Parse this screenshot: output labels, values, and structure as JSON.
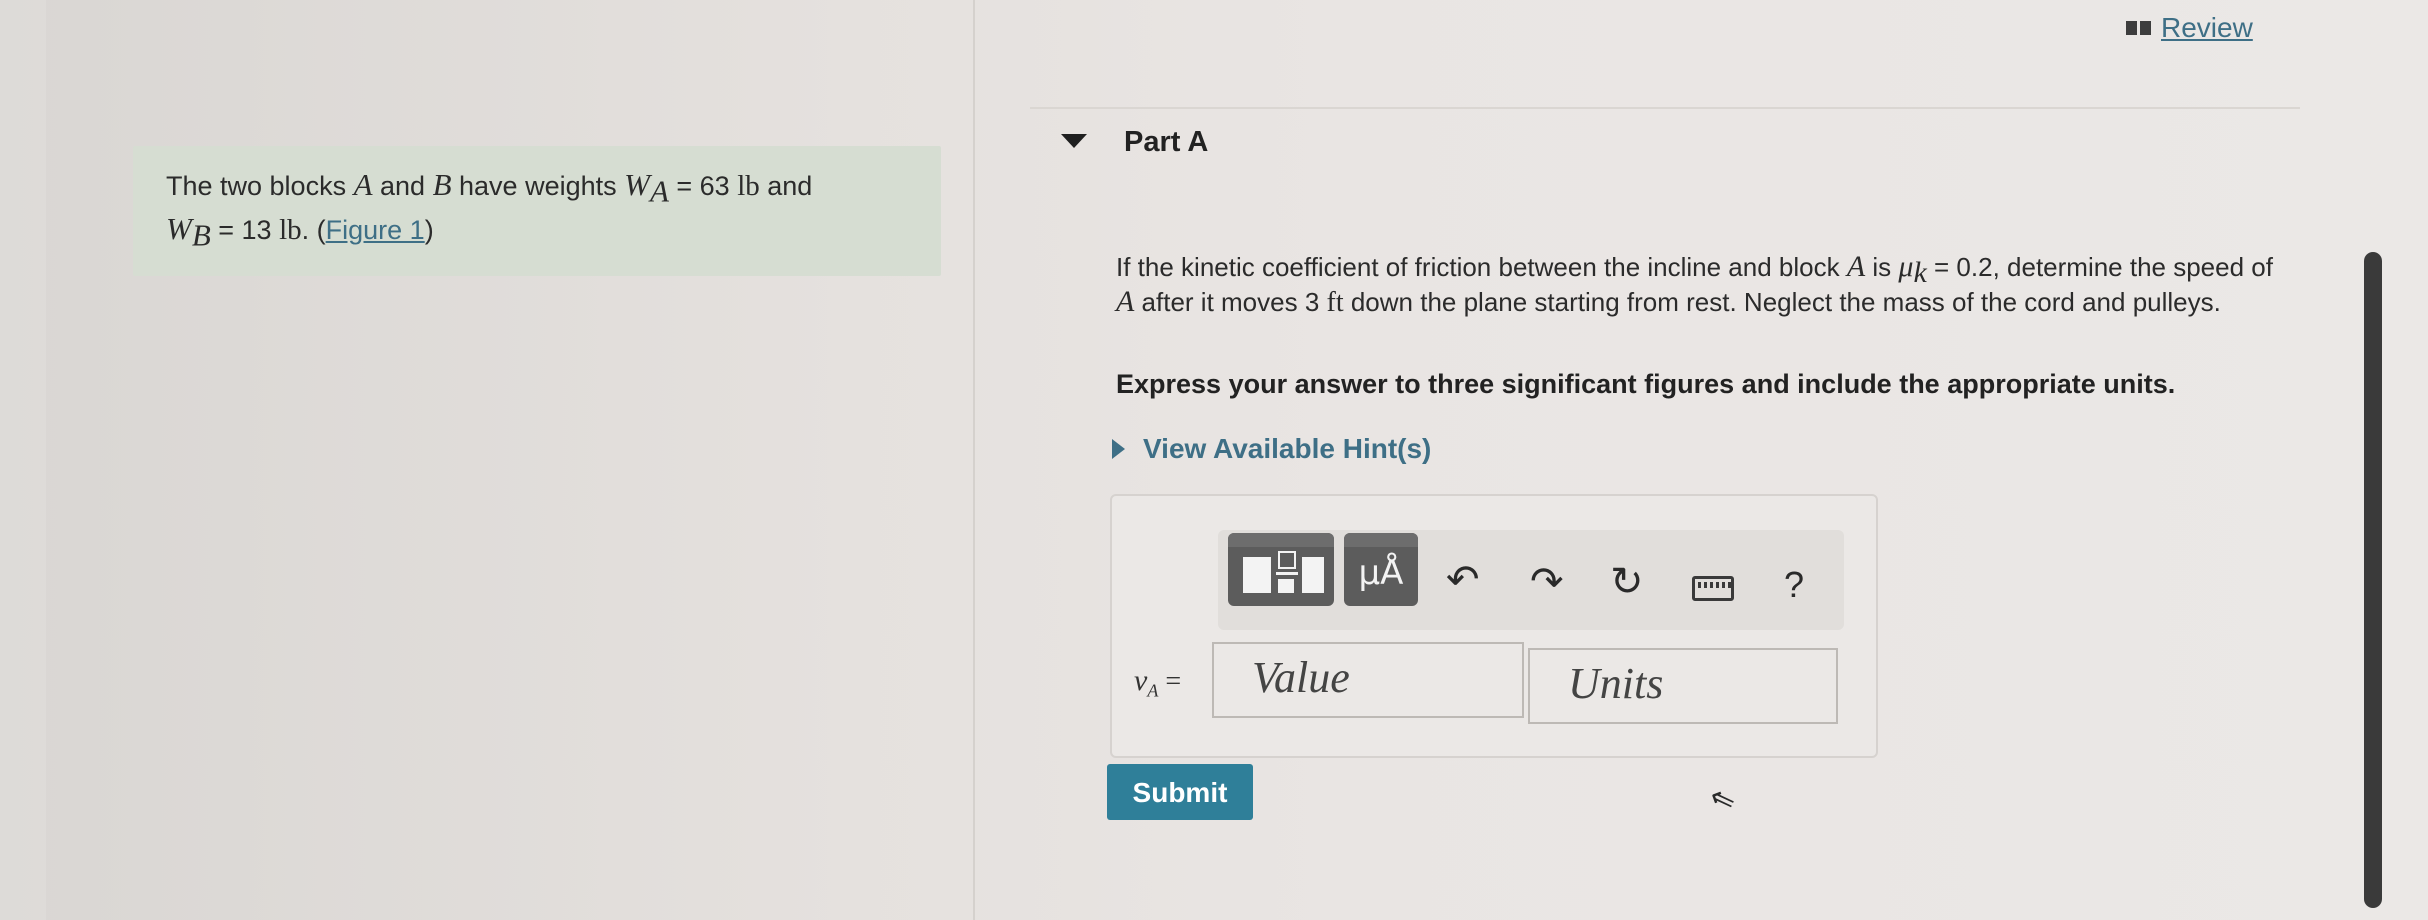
{
  "header": {
    "review_label": "Review"
  },
  "problem": {
    "text_intro": "The two blocks ",
    "block_a": "A",
    "and": " and ",
    "block_b": "B",
    "text_weights": " have weights ",
    "wa_sym": "W",
    "wa_sub": "A",
    "wa_val": " = 63 ",
    "unit_lb": "lb",
    "and2": " and",
    "wb_sym": "W",
    "wb_sub": "B",
    "wb_val": " = 13 ",
    "unit_lb2": "lb",
    "period": ". (",
    "figure_link": "Figure 1",
    "close_paren": ")"
  },
  "part": {
    "title": "Part A",
    "q1": "If the kinetic coefficient of friction between the incline and block ",
    "q_block": "A",
    "q2": " is ",
    "mu": "μ",
    "mu_sub": "k",
    "q3": " = 0.2, determine the speed of ",
    "q_block2": "A",
    "q4": " after it moves 3 ",
    "q_unit": "ft",
    "q5": " down the plane starting from rest. Neglect the mass of the cord and pulleys.",
    "instruction": "Express your answer to three significant figures and include the appropriate units.",
    "hint_label": "View Available Hint(s)"
  },
  "toolbar": {
    "units_btn": "μÅ",
    "undo_icon": "↶",
    "redo_icon": "↷",
    "reset_icon": "↻",
    "help": "?"
  },
  "answer": {
    "var_sym": "v",
    "var_sub": "A",
    "equals": " =",
    "value_placeholder": "Value",
    "units_placeholder": "Units",
    "submit_label": "Submit"
  },
  "colors": {
    "link": "#3e6f86",
    "submit_bg": "#2f7f99",
    "problem_bg": "#d6ddd2"
  }
}
